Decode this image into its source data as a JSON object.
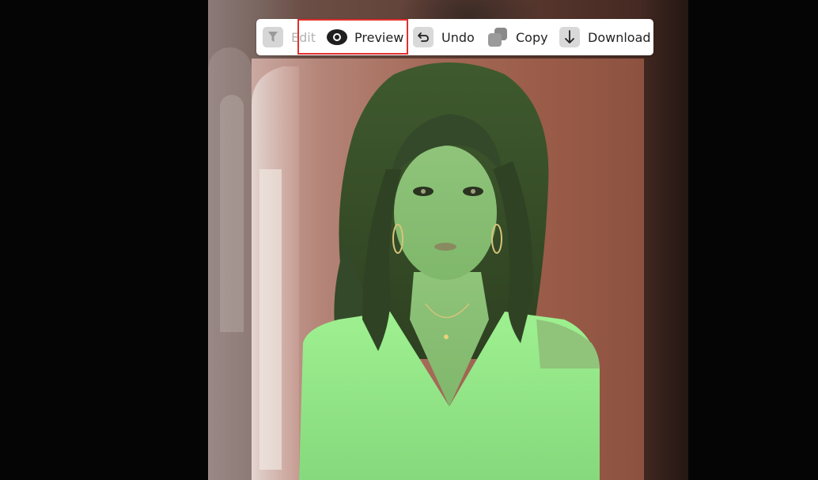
{
  "toolbar": {
    "items": [
      {
        "label": "Edit",
        "icon": "funnel-icon",
        "enabled": false
      },
      {
        "label": "Preview",
        "icon": "eye-icon",
        "enabled": true,
        "highlighted": true
      },
      {
        "label": "Undo",
        "icon": "undo-icon",
        "enabled": true
      },
      {
        "label": "Copy",
        "icon": "copy-icon",
        "enabled": true
      },
      {
        "label": "Download",
        "icon": "download-icon",
        "enabled": true
      }
    ]
  },
  "colors": {
    "highlight": "#e0302e",
    "toolbar_bg": "#ffffff",
    "page_bg": "#050505",
    "tint_green": "#8ee68a"
  }
}
